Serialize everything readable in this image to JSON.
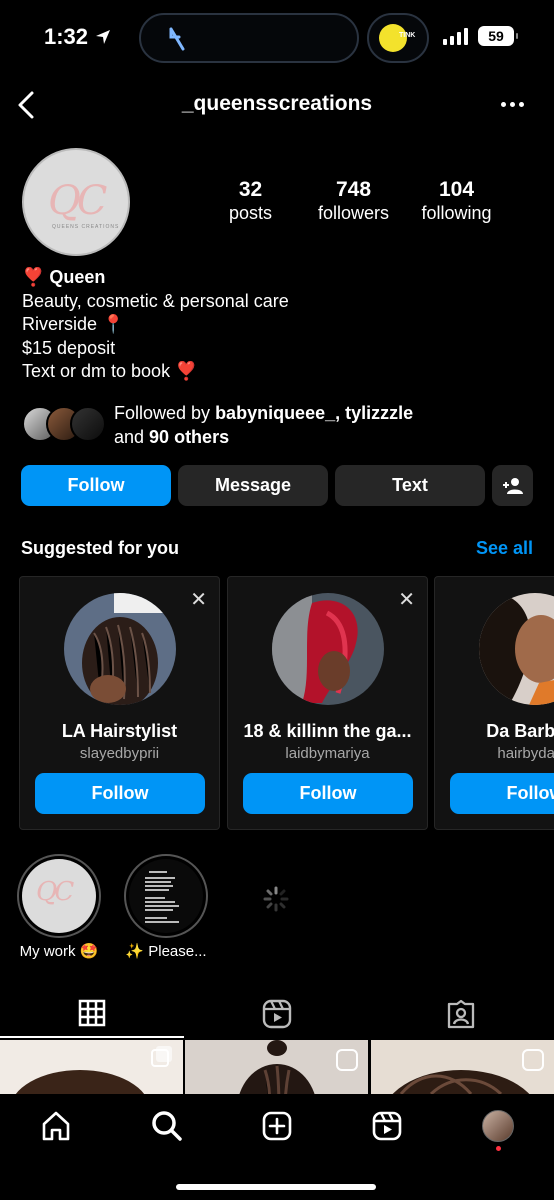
{
  "status_bar": {
    "time": "1:32",
    "battery": "59",
    "island_label": "TINK"
  },
  "header": {
    "username": "_queensscreations"
  },
  "profile": {
    "avatar_text": "QC",
    "avatar_subtext": "QUEENS CREATIONS",
    "stats": [
      {
        "value": "32",
        "label": "posts"
      },
      {
        "value": "748",
        "label": "followers"
      },
      {
        "value": "104",
        "label": "following"
      }
    ],
    "bio_name": "❣️ Queen",
    "bio_lines": [
      "Beauty, cosmetic & personal care",
      "Riverside 📍",
      "$15 deposit",
      "Text or dm to book ❣️"
    ],
    "followed_by_prefix": "Followed by ",
    "followed_by_users": "babyniqueee_, tylizzzle",
    "followed_by_and": "and ",
    "followed_by_others": "90 others"
  },
  "actions": {
    "follow": "Follow",
    "message": "Message",
    "text": "Text"
  },
  "suggested": {
    "title": "Suggested for you",
    "see_all": "See all",
    "cards": [
      {
        "name": "LA Hairstylist",
        "handle": "slayedbyprii",
        "button": "Follow"
      },
      {
        "name": "18 & killinn the ga...",
        "handle": "laidbymariya",
        "button": "Follow"
      },
      {
        "name": "Da Barb 💗",
        "handle": "hairbydaba",
        "button": "Follow"
      }
    ]
  },
  "highlights": [
    {
      "label": "My work 🤩"
    },
    {
      "label": "✨ Please..."
    }
  ],
  "colors": {
    "accent": "#0095f6",
    "button_dark": "#262626",
    "background": "#000000"
  }
}
